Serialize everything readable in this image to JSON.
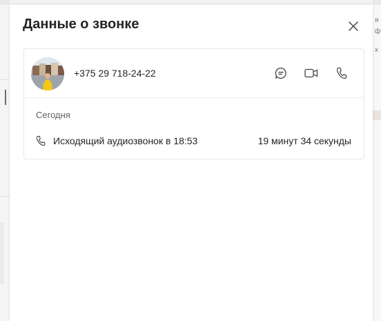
{
  "panel": {
    "title": "Данные о звонке"
  },
  "contact": {
    "phone": "+375 29 718-24-22"
  },
  "actions": [
    {
      "icon": "chat-icon"
    },
    {
      "icon": "video-camera-icon"
    },
    {
      "icon": "phone-icon"
    }
  ],
  "history": {
    "section_label": "Сегодня",
    "calls": [
      {
        "icon": "phone-icon",
        "description": "Исходящий аудиозвонок в 18:53",
        "duration": "19 минут 34 секунды"
      }
    ]
  },
  "background": {
    "right_edge_glyphs": [
      "я",
      "ф",
      "х"
    ]
  },
  "colors": {
    "panel_background": "#ffffff",
    "text_primary": "#242424",
    "text_secondary": "#616161",
    "border": "#e8e8e8",
    "avatar_shirt": "#f5c518"
  }
}
